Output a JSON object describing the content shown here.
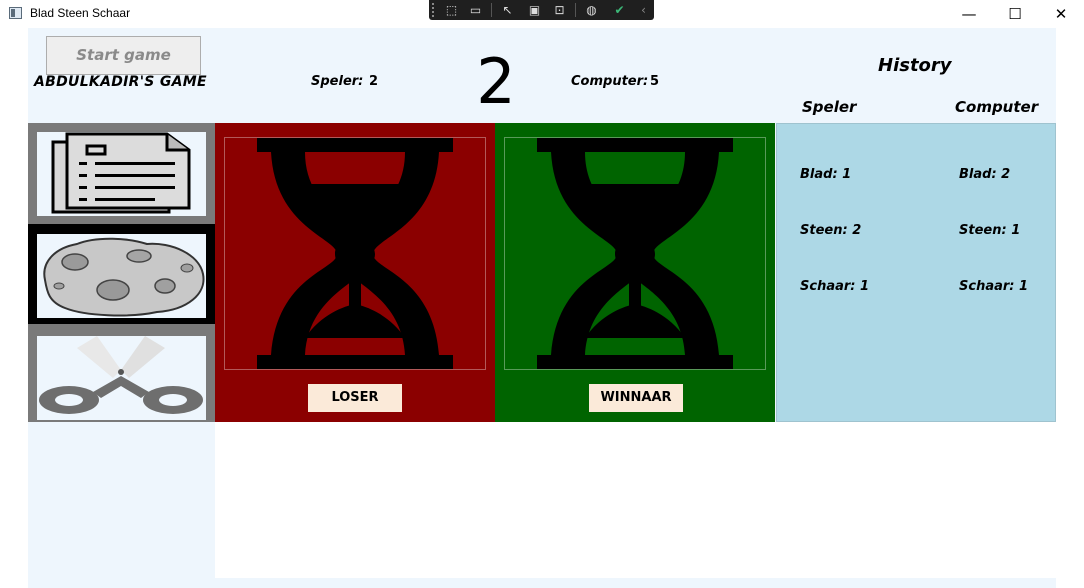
{
  "window": {
    "title": "Blad Steen Schaar",
    "controls": {
      "minimize": "—",
      "maximize": "☐",
      "close": "✕"
    }
  },
  "devtools": {
    "tools": [
      "select-element-icon",
      "camera-icon",
      "pointer-icon",
      "adorner-icon",
      "track-focus-icon",
      "hot-reload-icon",
      "check-icon",
      "collapse-icon"
    ]
  },
  "header": {
    "start_button": "Start game",
    "game_title": "ABDULKADIR'S GAME",
    "player_label": "Speler:",
    "player_score": "2",
    "countdown": "2",
    "computer_label": "Computer:",
    "computer_score": "5"
  },
  "choices": [
    {
      "name": "paper",
      "icon": "paper-icon",
      "selected": false
    },
    {
      "name": "rock",
      "icon": "rock-icon",
      "selected": true
    },
    {
      "name": "scissors",
      "icon": "scissors-icon",
      "selected": false
    }
  ],
  "panels": {
    "left": {
      "label": "LOSER",
      "color": "#8b0000",
      "icon": "hourglass-icon"
    },
    "right": {
      "label": "WINNAAR",
      "color": "#006400",
      "icon": "hourglass-icon"
    }
  },
  "history": {
    "title": "History",
    "col_player": "Speler",
    "col_computer": "Computer",
    "player": [
      "Blad: 1",
      "Steen: 2",
      "Schaar: 1"
    ],
    "computer": [
      "Blad: 2",
      "Steen: 1",
      "Schaar: 1"
    ],
    "background": "#add8e6"
  }
}
